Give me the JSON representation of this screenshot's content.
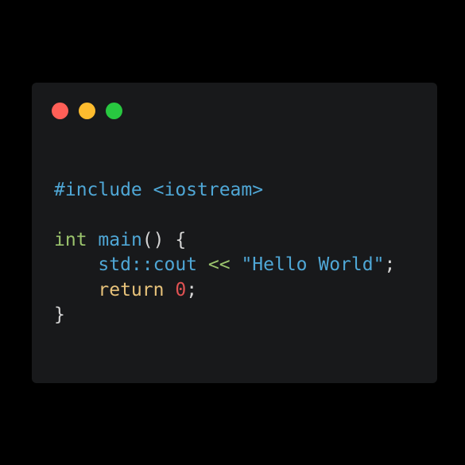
{
  "window": {
    "dots": [
      {
        "name": "close",
        "color": "#ff5f57"
      },
      {
        "name": "minimize",
        "color": "#febc2e"
      },
      {
        "name": "zoom",
        "color": "#28c840"
      }
    ]
  },
  "colors": {
    "background": "#000000",
    "window": "#18191b",
    "text": "#d4d4d4",
    "blue": "#4fa7d6",
    "green": "#9bc46d",
    "yellow": "#e7c27a",
    "red": "#e05252"
  },
  "code": {
    "line1": {
      "directive": "#include <iostream>"
    },
    "line3": {
      "type": "int",
      "fn": "main",
      "rest": "() {"
    },
    "line4": {
      "indent": "    ",
      "obj": "std::cout",
      "op": "<<",
      "str": "\"Hello World\"",
      "end": ";"
    },
    "line5": {
      "indent": "    ",
      "kw": "return",
      "num": "0",
      "end": ";"
    },
    "line6": {
      "brace": "}"
    }
  }
}
